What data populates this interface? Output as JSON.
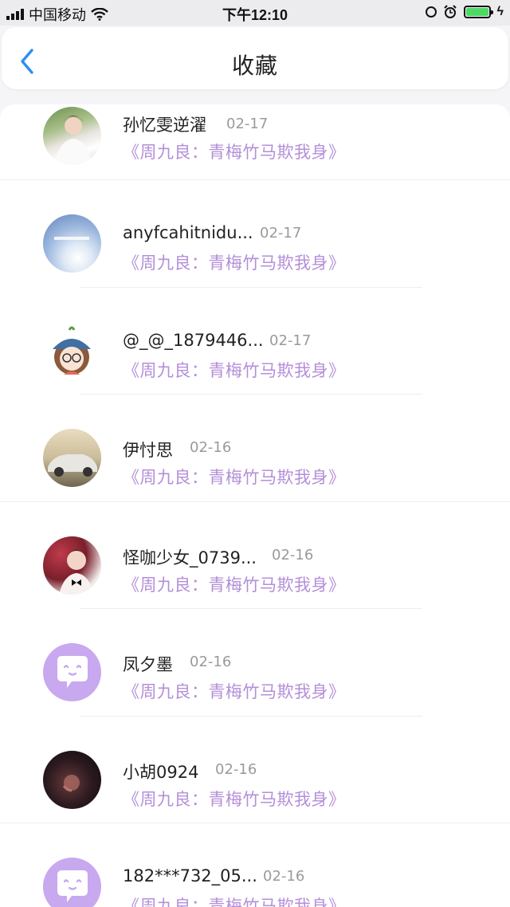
{
  "status_bar": {
    "carrier": "中国移动",
    "time": "下午12:10",
    "battery_percent": 100
  },
  "header": {
    "title": "收藏",
    "back_icon": "chevron-left-icon"
  },
  "colors": {
    "accent_blue": "#2e8ef0",
    "book_purple": "#b48fd9",
    "date_gray": "#9a9a9a",
    "battery_green": "#4cd964"
  },
  "list": {
    "items": [
      {
        "name": "孙忆雯逆濯",
        "date": "02-17",
        "book": "《周九良：青梅竹马欺我身》",
        "avatar": "photo-boy"
      },
      {
        "name": "anyfcahitnidu...",
        "date": "02-17",
        "book": "《周九良：青梅竹马欺我身》",
        "avatar": "sky-clouds"
      },
      {
        "name": "@_@_1879446...",
        "date": "02-17",
        "book": "《周九良：青梅竹马欺我身》",
        "avatar": "cartoon-girl"
      },
      {
        "name": "伊忖思",
        "date": "02-16",
        "book": "《周九良：青梅竹马欺我身》",
        "avatar": "car"
      },
      {
        "name": "怪咖少女_0739...",
        "date": "02-16",
        "book": "《周九良：青梅竹马欺我身》",
        "avatar": "photo-boy-bowtie"
      },
      {
        "name": "凤夕墨",
        "date": "02-16",
        "book": "《周九良：青梅竹马欺我身》",
        "avatar": "default-chat-bubble"
      },
      {
        "name": "小胡0924",
        "date": "02-16",
        "book": "《周九良：青梅竹马欺我身》",
        "avatar": "dark-portrait"
      },
      {
        "name": "182***732_05...",
        "date": "02-16",
        "book": "《周九良：青梅竹马欺我身》",
        "avatar": "default-chat-bubble"
      }
    ]
  }
}
